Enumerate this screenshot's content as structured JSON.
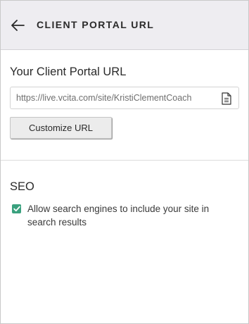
{
  "header": {
    "back_icon": "arrow-left-icon",
    "title": "CLIENT PORTAL URL"
  },
  "portal_url": {
    "section_title": "Your Client Portal URL",
    "url_value": "https://live.vcita.com/site/KristiClementCoach",
    "copy_icon": "document-copy-icon",
    "customize_button_label": "Customize URL"
  },
  "seo": {
    "section_title": "SEO",
    "allow_search_engines": {
      "checked": true,
      "label": "Allow search engines to include your site in search results"
    }
  },
  "colors": {
    "header_bg": "#eeedf1",
    "checkbox_green": "#3aa17e",
    "button_bg": "#ececec"
  }
}
